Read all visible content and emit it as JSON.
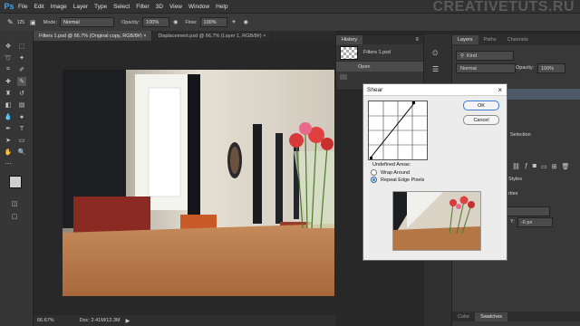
{
  "app": {
    "logo": "Ps",
    "watermark": "CREATIVETUTS.RU"
  },
  "menu": [
    "File",
    "Edit",
    "Image",
    "Layer",
    "Type",
    "Select",
    "Filter",
    "3D",
    "View",
    "Window",
    "Help"
  ],
  "options_bar": {
    "brush_size": "125",
    "mode_label": "Mode:",
    "mode_value": "Normal",
    "opacity_label": "Opacity:",
    "opacity_value": "100%",
    "flow_label": "Flow:",
    "flow_value": "100%"
  },
  "doc_tabs": [
    {
      "label": "Filters 1.psd @ 66.7% (Original copy, RGB/8#) ×",
      "active": true
    },
    {
      "label": "Displacement.psd @ 66.7% (Layer 1, RGB/8#) ×",
      "active": false
    }
  ],
  "status": {
    "zoom": "66.67%",
    "doc": "Doc: 2.41M/12.3M"
  },
  "history": {
    "tab": "History",
    "snapshot": "Filters 1.psd",
    "step": "Open"
  },
  "layers_panel": {
    "tabs": [
      "Layers",
      "Paths",
      "Channels"
    ],
    "kind": "Kind",
    "blend": "Normal",
    "opacity_label": "Opacity:",
    "opacity_value": "100%",
    "selection_text": "Selection",
    "styles_tab": "Styles",
    "properties_label": "rties",
    "y_label": "Y:",
    "y_value": "-6 px"
  },
  "bottom_tabs": [
    "Color",
    "Swatches"
  ],
  "shear_dialog": {
    "title": "Shear",
    "ok": "OK",
    "cancel": "Cancel",
    "undefined_areas": "Undefined Areas:",
    "options": [
      "Wrap Around",
      "Repeat Edge Pixels"
    ],
    "selected_option": "Repeat Edge Pixels"
  }
}
